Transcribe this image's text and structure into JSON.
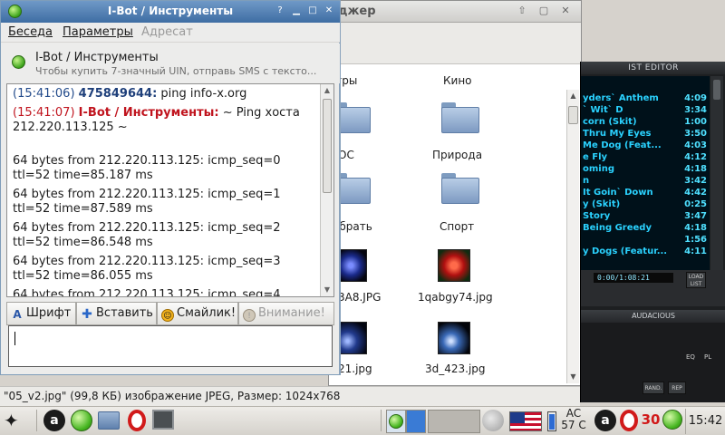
{
  "file_manager": {
    "title": "джер",
    "items": [
      {
        "label": "гры",
        "type": "folder-label-partial"
      },
      {
        "label": "Кино",
        "type": "folder"
      },
      {
        "label": "ОС",
        "type": "folder"
      },
      {
        "label": "Природа",
        "type": "folder"
      },
      {
        "label": "обрать",
        "type": "folder"
      },
      {
        "label": "Спорт",
        "type": "folder"
      },
      {
        "label": "3A8.JPG",
        "type": "image"
      },
      {
        "label": "1qabgy74.jpg",
        "type": "image"
      },
      {
        "label": "21.jpg",
        "type": "image"
      },
      {
        "label": "3d_423.jpg",
        "type": "image"
      }
    ],
    "status": "\"05_v2.jpg\" (99,8 КБ) изображение JPEG, Размер: 1024x768"
  },
  "chat": {
    "title": "I-Bot / Инструменты",
    "menu": {
      "conversation": "Беседа",
      "parameters": "Параметры",
      "addressee": "Адресат"
    },
    "contact_name": "I-Bot / Инструменты",
    "contact_status": "Чтобы купить 7-значный UIN, отправь SMS с тексто...",
    "messages": {
      "m1_time": "(15:41:06)",
      "m1_nick": "475849644:",
      "m1_text": "ping info-x.org",
      "m2_time": "(15:41:07)",
      "m2_nick": "I-Bot / Инструменты:",
      "m2_text": "~ Ping хоста 212.220.113.125 ~",
      "lines": [
        "64 bytes from 212.220.113.125: icmp_seq=0 ttl=52 time=85.187 ms",
        "64 bytes from 212.220.113.125: icmp_seq=1 ttl=52 time=87.589 ms",
        "64 bytes from 212.220.113.125: icmp_seq=2 ttl=52 time=86.548 ms",
        "64 bytes from 212.220.113.125: icmp_seq=3 ttl=52 time=86.055 ms",
        "64 bytes from 212.220.113.125: icmp_seq=4"
      ]
    },
    "toolbar": {
      "font": "Шрифт",
      "insert": "Вставить",
      "smiley": "Смайлик!",
      "attention": "Внимание!"
    },
    "input_value": ""
  },
  "player": {
    "playlist_title": "IST EDITOR",
    "songs": [
      {
        "title": "yders` Anthem",
        "duration": "4:09"
      },
      {
        "title": "` Wit` D",
        "duration": "3:34"
      },
      {
        "title": "corn (Skit)",
        "duration": "1:00"
      },
      {
        "title": "Thru My Eyes",
        "duration": "3:50"
      },
      {
        "title": "Me Dog (Feat...",
        "duration": "4:03"
      },
      {
        "title": "e Fly",
        "duration": "4:12"
      },
      {
        "title": "oming",
        "duration": "4:18"
      },
      {
        "title": "n",
        "duration": "3:42"
      },
      {
        "title": "It Goin` Down",
        "duration": "4:42"
      },
      {
        "title": "y (Skit)",
        "duration": "0:25"
      },
      {
        "title": "Story",
        "duration": "3:47"
      },
      {
        "title": "Being Greedy",
        "duration": "4:18"
      },
      {
        "title": "",
        "duration": "1:56"
      },
      {
        "title": "y Dogs (Featur...",
        "duration": "4:11"
      }
    ],
    "time_display": "0:00/1:08:21",
    "load_list": "LOAD LIST",
    "main_title": "AUDACIOUS",
    "eq_label": "EQ",
    "pl_label": "PL",
    "rand": "RAND.",
    "rep": "REP"
  },
  "taskbar": {
    "ac_label": "AC",
    "temperature": "57 C",
    "counter": "30",
    "clock": "15:42"
  },
  "colors": {
    "titlebar_active": "#3e6da3",
    "nick_blue": "#1e3f7a",
    "nick_red": "#c0141e",
    "playlist_text": "#2ad2ff"
  }
}
